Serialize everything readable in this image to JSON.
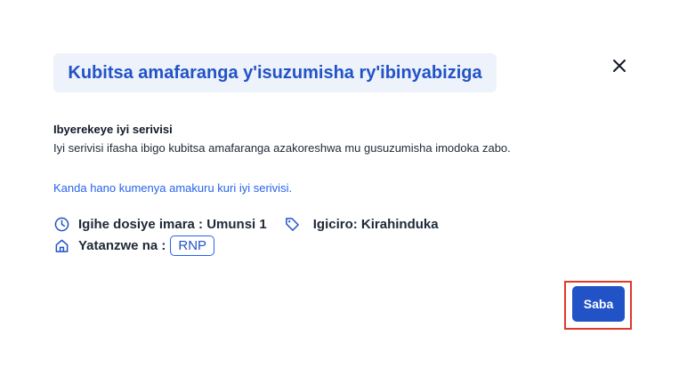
{
  "header": {
    "title": "Kubitsa amafaranga y'isuzumisha ry'ibinyabiziga",
    "close_icon": "close-icon"
  },
  "description": {
    "heading": "Ibyerekeye iyi serivisi",
    "text": "Iyi serivisi ifasha ibigo kubitsa amafaranga azakoreshwa mu gusuzumisha imodoka zabo."
  },
  "link": {
    "text": "Kanda hano kumenya amakuru kuri iyi serivisi."
  },
  "info": {
    "duration": "Igihe dosiye imara : Umunsi 1",
    "price": "Igiciro: Kirahinduka",
    "provider_label": "Yatanzwe na :",
    "provider_badge": "RNP",
    "icons": [
      "clock-icon",
      "tag-icon",
      "home-icon"
    ]
  },
  "actions": {
    "submit_label": "Saba"
  },
  "colors": {
    "accent": "#2153c7",
    "title_bg": "#eef2fa",
    "link": "#2563eb",
    "highlight": "#e0382b"
  }
}
